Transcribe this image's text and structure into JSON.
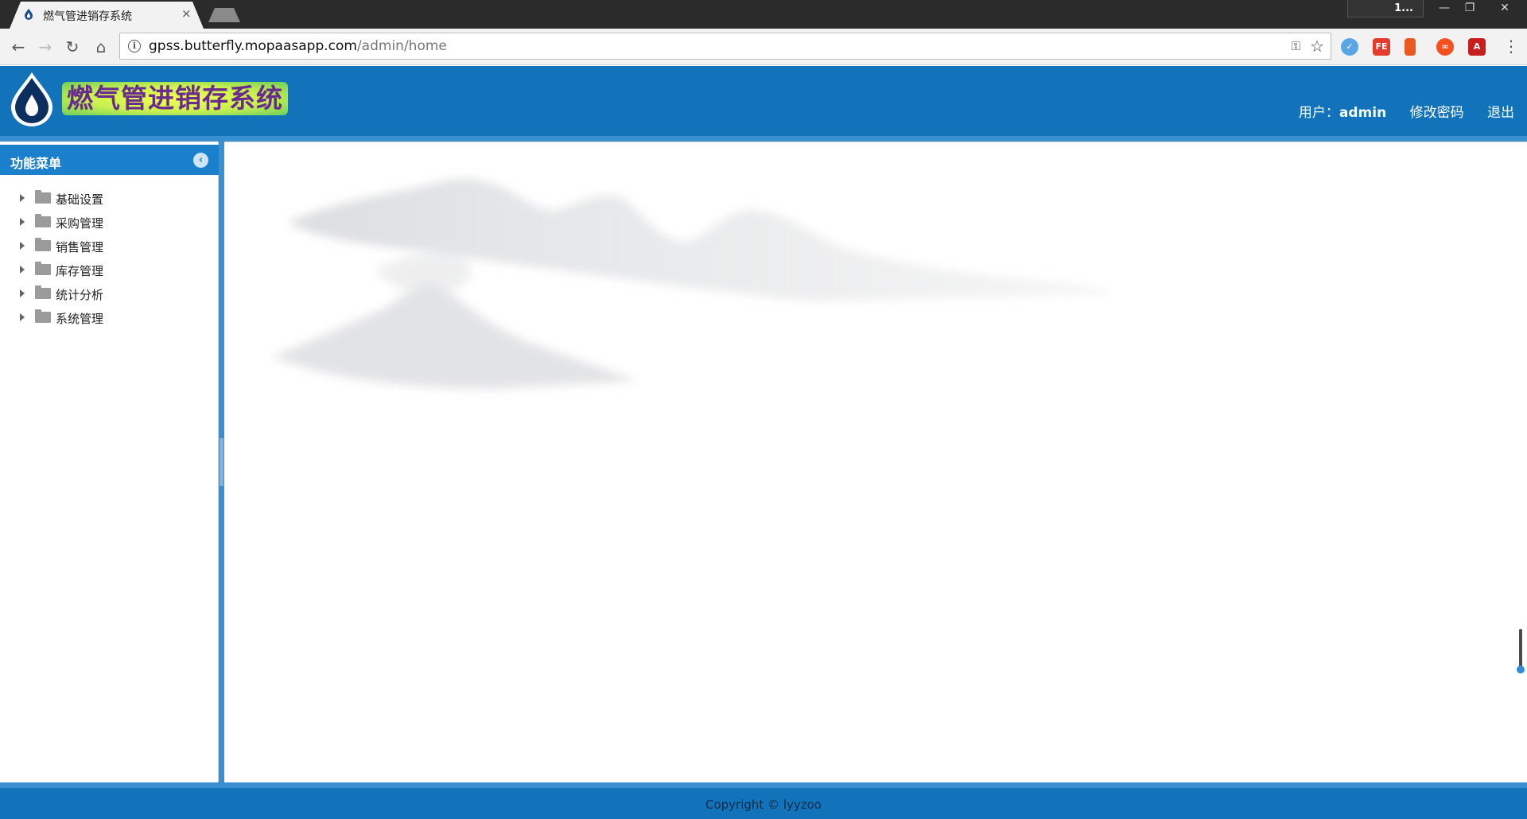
{
  "browser": {
    "tab_title": "燃气管进销存系统",
    "tab_close": "×",
    "profile_label": "1...",
    "window_min": "—",
    "window_max": "❐",
    "window_close": "✕",
    "url_host": "gpss.butterfly.mopaasapp.com",
    "url_path": "/admin/home",
    "nav_back": "←",
    "nav_forward": "→",
    "nav_reload": "↻",
    "nav_home": "⌂",
    "info_glyph": "i",
    "key_glyph": "⚿",
    "star_glyph": "☆",
    "menu_glyph": "⋮",
    "extensions": [
      {
        "name": "feedly-like-icon",
        "glyph": "✓"
      },
      {
        "name": "fe-helper-icon",
        "glyph": "FE"
      },
      {
        "name": "office-icon",
        "glyph": ""
      },
      {
        "name": "infinity-icon",
        "glyph": "∞"
      },
      {
        "name": "acrobat-icon",
        "glyph": "A"
      }
    ]
  },
  "app": {
    "logo_title": "燃气管进销存系统",
    "user_label": "用户：",
    "user_name": "admin",
    "change_password": "修改密码",
    "logout": "退出",
    "colors": {
      "header": "#1273bb",
      "accent": "#1a80cc",
      "separator": "#3a8fd1"
    }
  },
  "sidebar": {
    "title": "功能菜单",
    "collapse_glyph": "‹",
    "items": [
      {
        "label": "基础设置"
      },
      {
        "label": "采购管理"
      },
      {
        "label": "销售管理"
      },
      {
        "label": "库存管理"
      },
      {
        "label": "统计分析"
      },
      {
        "label": "系统管理"
      }
    ]
  },
  "footer": {
    "copyright": "Copyright © lyyzoo"
  }
}
